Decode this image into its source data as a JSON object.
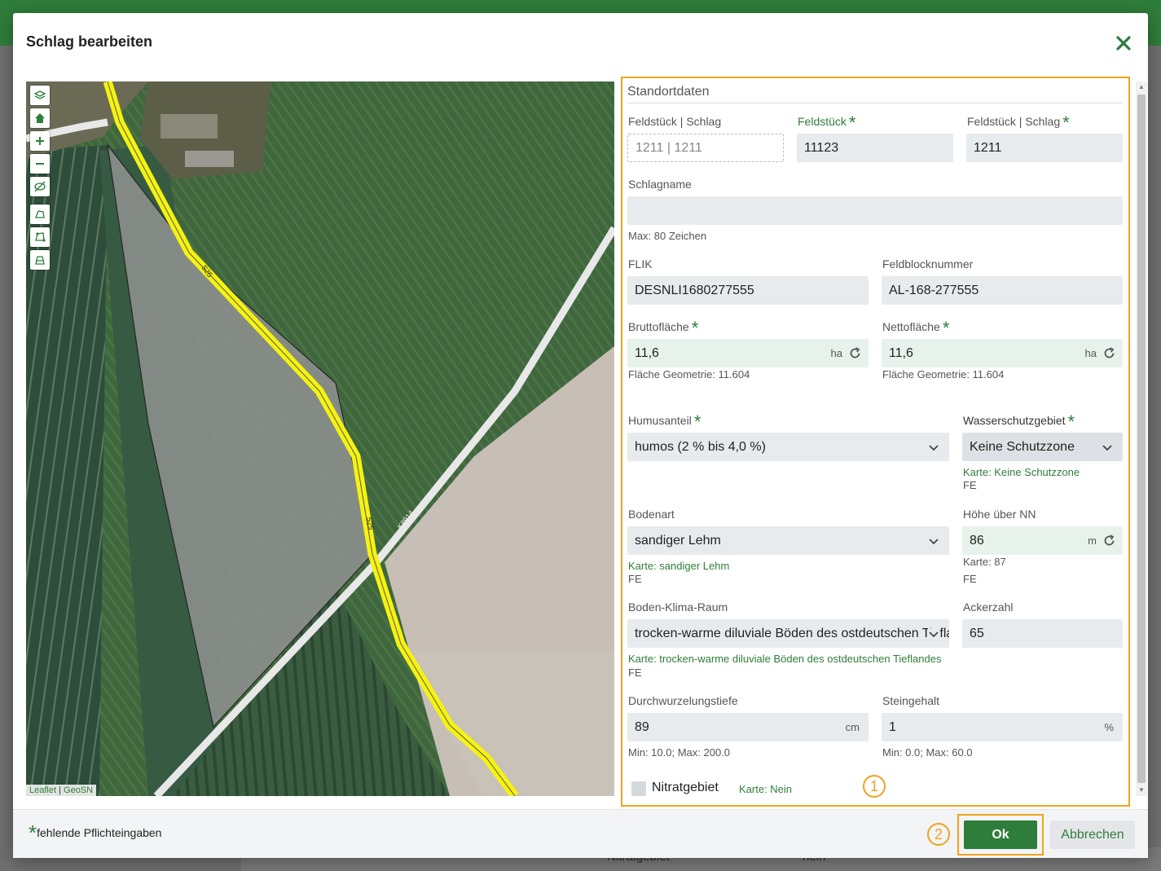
{
  "background": {
    "row_label": "Nitratgebiet",
    "row_value": "nein"
  },
  "dialog": {
    "title": "Schlag bearbeiten"
  },
  "map": {
    "tools": [
      "layers-icon",
      "home-icon",
      "zoom-in-icon",
      "zoom-out-icon",
      "hide-icon",
      "polygon-draw-icon",
      "polygon-edit-icon",
      "polygon-cut-icon"
    ],
    "attribution_leaflet": "Leaflet",
    "attribution_separator": "|",
    "attribution_geosn": "GeoSN",
    "road_labels": [
      "S25",
      "S25",
      "K8914"
    ]
  },
  "form": {
    "section_title": "Standortdaten",
    "feldstueck_schlag_label": "Feldstück | Schlag",
    "feldstueck_schlag_value": "1211 | 1211",
    "feldstueck_label": "Feldstück",
    "feldstueck_value": "11123",
    "schlag_label": "Feldstück | Schlag",
    "schlag_value": "1211",
    "schlagname_label": "Schlagname",
    "schlagname_value": "",
    "schlagname_hint": "Max: 80 Zeichen",
    "flik_label": "FLIK",
    "flik_value": "DESNLI1680277555",
    "feldblock_label": "Feldblocknummer",
    "feldblock_value": "AL-168-277555",
    "brutto_label": "Bruttofläche",
    "brutto_value": "11,6",
    "brutto_unit": "ha",
    "brutto_hint": "Fläche Geometrie: 11.604",
    "netto_label": "Nettofläche",
    "netto_value": "11,6",
    "netto_unit": "ha",
    "netto_hint": "Fläche Geometrie: 11.604",
    "humus_label": "Humusanteil",
    "humus_value": "humos (2 % bis 4,0 %)",
    "wasser_label": "Wasserschutzgebiet",
    "wasser_value": "Keine Schutzzone",
    "wasser_hint": "Karte: Keine Schutzzone",
    "wasser_hint2": "FE",
    "bodenart_label": "Bodenart",
    "bodenart_value": "sandiger Lehm",
    "bodenart_hint": "Karte: sandiger Lehm",
    "bodenart_hint2": "FE",
    "hoehe_label": "Höhe über NN",
    "hoehe_value": "86",
    "hoehe_unit": "m",
    "hoehe_hint": "Karte: 87",
    "hoehe_hint2": "FE",
    "bkr_label": "Boden-Klima-Raum",
    "bkr_value": "trocken-warme diluviale Böden des ostdeutschen Tieflandes",
    "bkr_hint": "Karte: trocken-warme diluviale Böden des ostdeutschen Tieflandes",
    "bkr_hint2": "FE",
    "ackerzahl_label": "Ackerzahl",
    "ackerzahl_value": "65",
    "wurzel_label": "Durchwurzelungstiefe",
    "wurzel_value": "89",
    "wurzel_unit": "cm",
    "wurzel_hint": "Min: 10.0; Max: 200.0",
    "stein_label": "Steingehalt",
    "stein_value": "1",
    "stein_unit": "%",
    "stein_hint": "Min: 0.0; Max: 60.0",
    "nitrat_label": "Nitratgebiet",
    "nitrat_checked": false,
    "nitrat_hint": "Karte: Nein",
    "marker_1": "1"
  },
  "footer": {
    "required_star": "*",
    "required_note": "fehlende Pflichteingaben",
    "marker_2": "2",
    "ok_label": "Ok",
    "cancel_label": "Abbrechen"
  },
  "colors": {
    "accent": "#2f7d3a",
    "highlight": "#f0a41c",
    "field_bg": "#e8ebee"
  }
}
